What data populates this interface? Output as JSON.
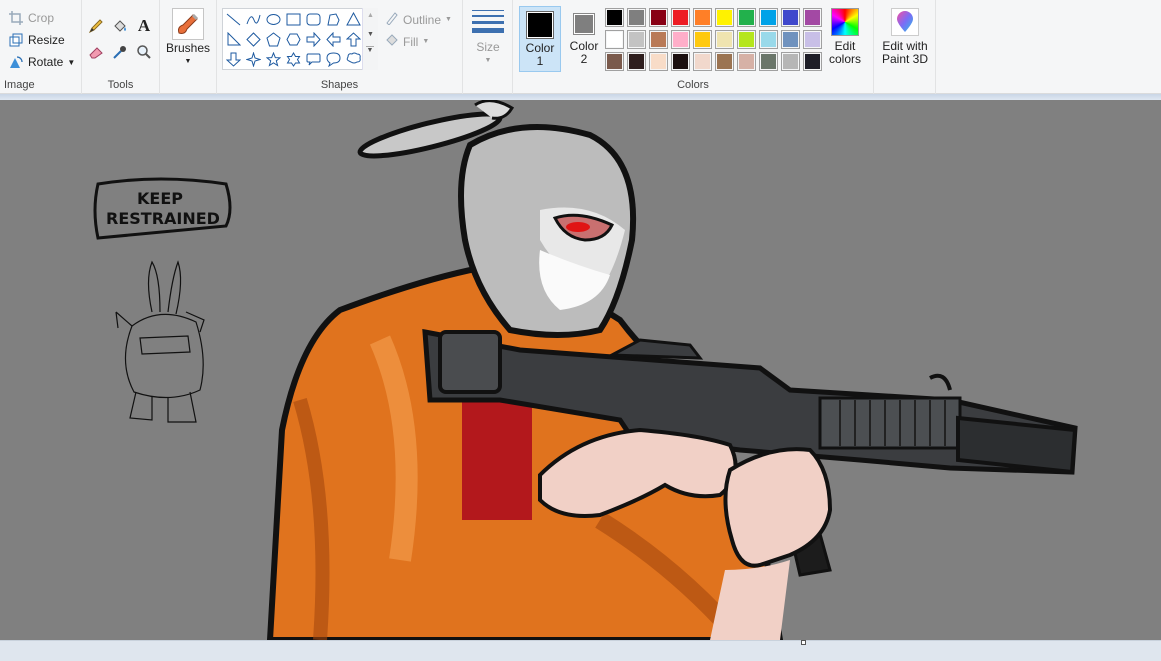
{
  "ribbon": {
    "image_group": {
      "label": "Image",
      "crop": "Crop",
      "resize": "Resize",
      "rotate": "Rotate"
    },
    "tools_group": {
      "label": "Tools"
    },
    "brushes": {
      "label": "Brushes"
    },
    "shapes_group": {
      "label": "Shapes",
      "outline": "Outline",
      "fill": "Fill"
    },
    "size": {
      "label": "Size"
    },
    "colors_group": {
      "label": "Colors",
      "color1": "Color 1",
      "color2": "Color 2",
      "edit_colors": "Edit colors",
      "edit_paint3d": "Edit with Paint 3D",
      "color1_value": "#000000",
      "color2_value": "#7f7f7f",
      "palette": [
        [
          "#000000",
          "#7f7f7f",
          "#880015",
          "#ed1c24",
          "#ff7f27",
          "#fff200",
          "#22b14c",
          "#00a2e8",
          "#3f48cc",
          "#a349a4"
        ],
        [
          "#ffffff",
          "#c3c3c3",
          "#b97a57",
          "#ffaec9",
          "#ffc90e",
          "#efe4b0",
          "#b5e61d",
          "#99d9ea",
          "#7092be",
          "#c8bfe7"
        ],
        [
          "#7a5a4c",
          "#2e1e1e",
          "#f8dcc8",
          "#1b0f0f",
          "#f1d8cc",
          "#9b7452",
          "#d6b1a6",
          "#6a766a",
          "#b6b6b6",
          "#1e1e28"
        ]
      ]
    }
  },
  "canvas": {
    "sign_text_line1": "KEEP",
    "sign_text_line2": "RESTRAINED"
  }
}
